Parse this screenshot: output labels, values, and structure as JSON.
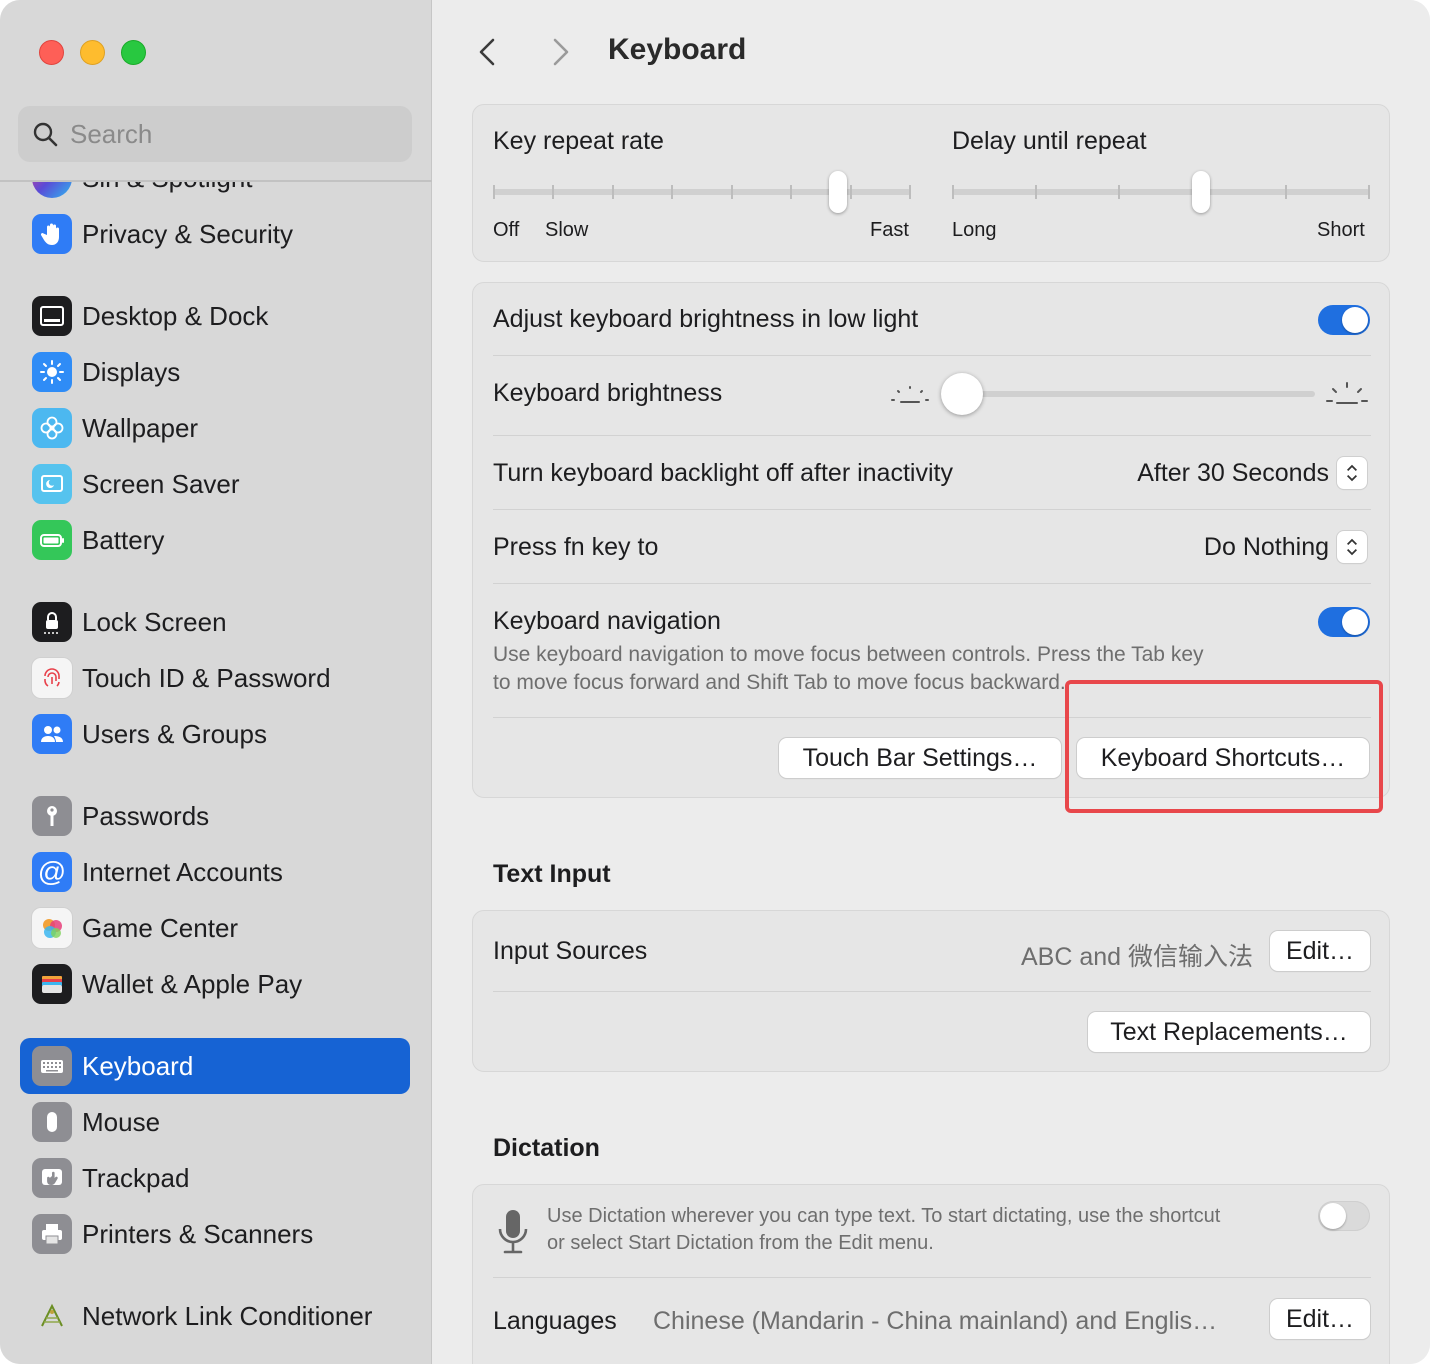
{
  "window": {
    "title": "Keyboard"
  },
  "search": {
    "placeholder": "Search"
  },
  "sidebar": {
    "items": [
      {
        "label": "Siri & Spotlight",
        "icon": "siri-icon",
        "color": "#5a4bd6"
      },
      {
        "label": "Privacy & Security",
        "icon": "hand-icon",
        "color": "#2f7cf6"
      },
      {
        "label": "Desktop & Dock",
        "icon": "dock-icon",
        "color": "#1d1d1f"
      },
      {
        "label": "Displays",
        "icon": "sun-icon",
        "color": "#2f8cf6"
      },
      {
        "label": "Wallpaper",
        "icon": "flower-icon",
        "color": "#4cb8f0"
      },
      {
        "label": "Screen Saver",
        "icon": "screen-saver-icon",
        "color": "#56c3ee"
      },
      {
        "label": "Battery",
        "icon": "battery-icon",
        "color": "#34c759"
      },
      {
        "label": "Lock Screen",
        "icon": "lock-icon",
        "color": "#1d1d1f"
      },
      {
        "label": "Touch ID & Password",
        "icon": "fingerprint-icon",
        "color": "#f5f5f5"
      },
      {
        "label": "Users & Groups",
        "icon": "users-icon",
        "color": "#2f7cf6"
      },
      {
        "label": "Passwords",
        "icon": "key-icon",
        "color": "#8e8e93"
      },
      {
        "label": "Internet Accounts",
        "icon": "at-icon",
        "color": "#2f7cf6"
      },
      {
        "label": "Game Center",
        "icon": "game-center-icon",
        "color": "#f5f5f5"
      },
      {
        "label": "Wallet & Apple Pay",
        "icon": "wallet-icon",
        "color": "#1d1d1f"
      },
      {
        "label": "Keyboard",
        "icon": "keyboard-icon",
        "color": "#8e8e93"
      },
      {
        "label": "Mouse",
        "icon": "mouse-icon",
        "color": "#8e8e93"
      },
      {
        "label": "Trackpad",
        "icon": "trackpad-icon",
        "color": "#8e8e93"
      },
      {
        "label": "Printers & Scanners",
        "icon": "printer-icon",
        "color": "#8e8e93"
      },
      {
        "label": "Network Link Conditioner",
        "icon": "network-link-icon",
        "color": "#6b8e23"
      }
    ],
    "selected": "Keyboard"
  },
  "key_repeat": {
    "rate_label": "Key repeat rate",
    "rate_off": "Off",
    "rate_slow": "Slow",
    "rate_fast": "Fast",
    "rate_value": 0.84,
    "delay_label": "Delay until repeat",
    "delay_long": "Long",
    "delay_short": "Short",
    "delay_value": 0.6
  },
  "settings": {
    "adjust_brightness_label": "Adjust keyboard brightness in low light",
    "adjust_brightness_on": true,
    "brightness_label": "Keyboard brightness",
    "brightness_value": 0.0,
    "backlight_label": "Turn keyboard backlight off after inactivity",
    "backlight_value": "After 30 Seconds",
    "fn_label": "Press fn key to",
    "fn_value": "Do Nothing",
    "nav_label": "Keyboard navigation",
    "nav_on": true,
    "nav_desc_line1": "Use keyboard navigation to move focus between controls. Press the Tab key",
    "nav_desc_line2": "to move focus forward and Shift Tab to move focus backward.",
    "touch_bar_button": "Touch Bar Settings…",
    "shortcuts_button": "Keyboard Shortcuts…"
  },
  "text_input": {
    "section_title": "Text Input",
    "sources_label": "Input Sources",
    "sources_value": "ABC and 微信输入法",
    "edit_button": "Edit…",
    "replacements_button": "Text Replacements…"
  },
  "dictation": {
    "section_title": "Dictation",
    "desc_line1": "Use Dictation wherever you can type text. To start dictating, use the shortcut",
    "desc_line2": "or select Start Dictation from the Edit menu.",
    "enabled": false,
    "languages_label": "Languages",
    "languages_value": "Chinese (Mandarin - China mainland) and Englis…",
    "edit_button": "Edit…"
  },
  "colors": {
    "accent": "#1663d4",
    "highlight": "#e8474b",
    "toggle_on": "#1f6fe0"
  }
}
